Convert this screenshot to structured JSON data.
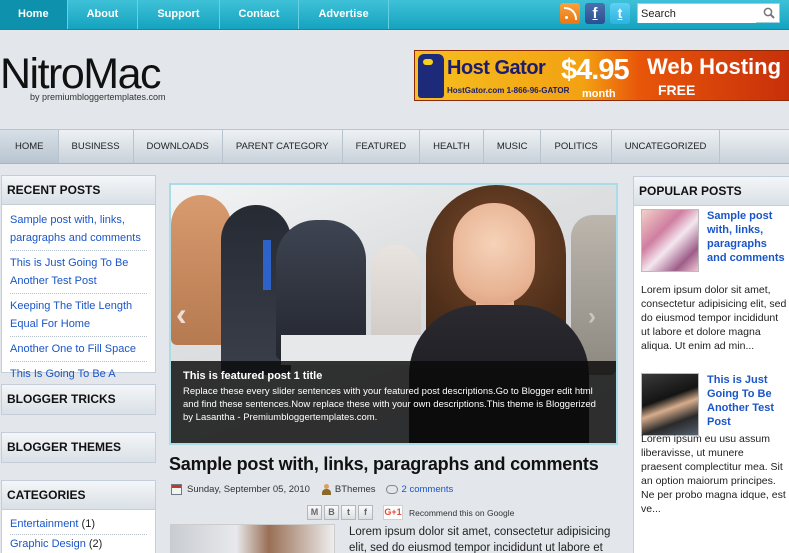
{
  "topnav": {
    "items": [
      "Home",
      "About",
      "Support",
      "Contact",
      "Advertise"
    ]
  },
  "search": {
    "placeholder": "Search"
  },
  "icons": {
    "rss": "rss-icon",
    "facebook": "facebook-icon",
    "twitter": "twitter-icon",
    "search": "search-icon"
  },
  "colors": {
    "accent": "#1aa7c2",
    "link": "#1a55c8"
  },
  "header": {
    "logo": "NitroMac",
    "logo_sub": "by premiumbloggertemplates.com"
  },
  "banner": {
    "brand": "Host Gator",
    "phone": "HostGator.com 1-866-96-GATOR",
    "price": "$4.95",
    "per": "month",
    "headline": "Web Hosting",
    "subline": "FREE SITEBUILDER"
  },
  "catnav": {
    "items": [
      "HOME",
      "BUSINESS",
      "DOWNLOADS",
      "PARENT CATEGORY",
      "FEATURED",
      "HEALTH",
      "MUSIC",
      "POLITICS",
      "UNCATEGORIZED"
    ]
  },
  "recent": {
    "title": "RECENT POSTS",
    "items": [
      "Sample post with, links, paragraphs and comments",
      "This is Just Going To Be Another Test Post",
      "Keeping The Title Length Equal For Home",
      "Another One to Fill Space",
      "This Is Going To Be A Decent Length Title With Little Text"
    ]
  },
  "widgets": {
    "tricks": "BLOGGER TRICKS",
    "themes": "BLOGGER THEMES"
  },
  "categories": {
    "title": "CATEGORIES",
    "items": [
      {
        "name": "Entertainment",
        "count": "(1)"
      },
      {
        "name": "Graphic Design",
        "count": "(2)"
      }
    ]
  },
  "slider": {
    "title": "This is featured post 1 title",
    "description": "Replace these every slider sentences with your featured post descriptions.Go to Blogger edit html and find these sentences.Now replace these with your own descriptions.This theme is Bloggerized by Lasantha - Premiumbloggertemplates.com."
  },
  "post": {
    "title": "Sample post with, links, paragraphs and comments",
    "date": "Sunday, September 05, 2010",
    "author": "BThemes",
    "comments": "2 comments",
    "share_recommend": "Recommend this on Google",
    "excerpt": "Lorem ipsum dolor sit amet, consectetur adipisicing elit, sed do eiusmod tempor incididunt ut labore et dolore magna aliqua."
  },
  "popular": {
    "title": "POPULAR POSTS",
    "items": [
      {
        "title": "Sample post with, links, paragraphs and comments",
        "text": "Lorem ipsum dolor sit amet, consectetur adipisicing elit, sed do eiusmod tempor incididunt ut labore et dolore magna aliqua. Ut enim ad min..."
      },
      {
        "title": "This is Just Going To Be Another Test Post",
        "text": "Lorem ipsum eu usu assum liberavisse, ut munere praesent complectitur mea. Sit an option maiorum principes. Ne per probo magna idque, est ve..."
      }
    ]
  }
}
